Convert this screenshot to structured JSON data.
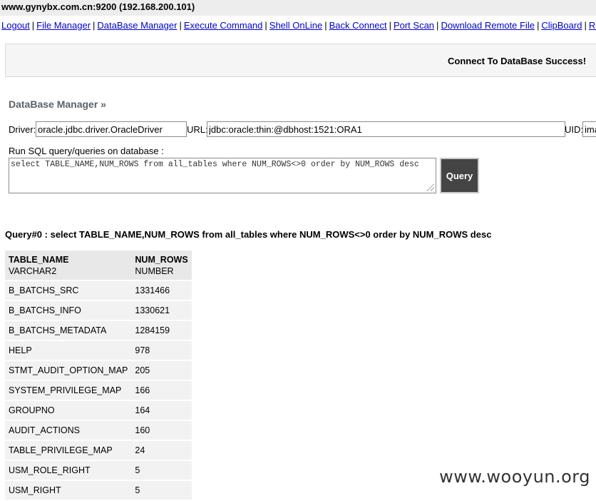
{
  "host": {
    "title": "www.gynybx.com.cn:9200 (192.168.200.101)"
  },
  "nav": {
    "items": [
      {
        "label": "Logout"
      },
      {
        "label": "File Manager"
      },
      {
        "label": "DataBase Manager"
      },
      {
        "label": "Execute Command"
      },
      {
        "label": "Shell OnLine"
      },
      {
        "label": "Back Connect"
      },
      {
        "label": "Port Scan"
      },
      {
        "label": "Download Remote File"
      },
      {
        "label": "ClipBoard"
      },
      {
        "label": "Remote Con"
      }
    ]
  },
  "status": {
    "message": "Connect To DataBase Success!"
  },
  "db": {
    "section_title": "DataBase Manager »",
    "driver_label": "Driver:",
    "driver_value": "oracle.jdbc.driver.OracleDriver",
    "url_label": "URL:",
    "url_value": "jdbc:oracle:thin:@dbhost:1521:ORA1",
    "uid_label": "UID:",
    "uid_value": "ima",
    "run_label": "Run SQL query/queries on database :",
    "sql_value": "select TABLE_NAME,NUM_ROWS from all_tables where NUM_ROWS<>0 order by NUM_ROWS desc",
    "query_button": "Query"
  },
  "result": {
    "title": "Query#0 : select TABLE_NAME,NUM_ROWS from all_tables where NUM_ROWS<>0 order by NUM_ROWS desc",
    "columns": [
      {
        "name": "TABLE_NAME",
        "type": "VARCHAR2"
      },
      {
        "name": "NUM_ROWS",
        "type": "NUMBER"
      }
    ],
    "rows": [
      [
        "B_BATCHS_SRC",
        "1331466"
      ],
      [
        "B_BATCHS_INFO",
        "1330621"
      ],
      [
        "B_BATCHS_METADATA",
        "1284159"
      ],
      [
        "HELP",
        "978"
      ],
      [
        "STMT_AUDIT_OPTION_MAP",
        "205"
      ],
      [
        "SYSTEM_PRIVILEGE_MAP",
        "166"
      ],
      [
        "GROUPNO",
        "164"
      ],
      [
        "AUDIT_ACTIONS",
        "160"
      ],
      [
        "TABLE_PRIVILEGE_MAP",
        "24"
      ],
      [
        "USM_ROLE_RIGHT",
        "5"
      ],
      [
        "USM_RIGHT",
        "5"
      ]
    ]
  },
  "watermark": {
    "text": "www.wooyun.org"
  }
}
